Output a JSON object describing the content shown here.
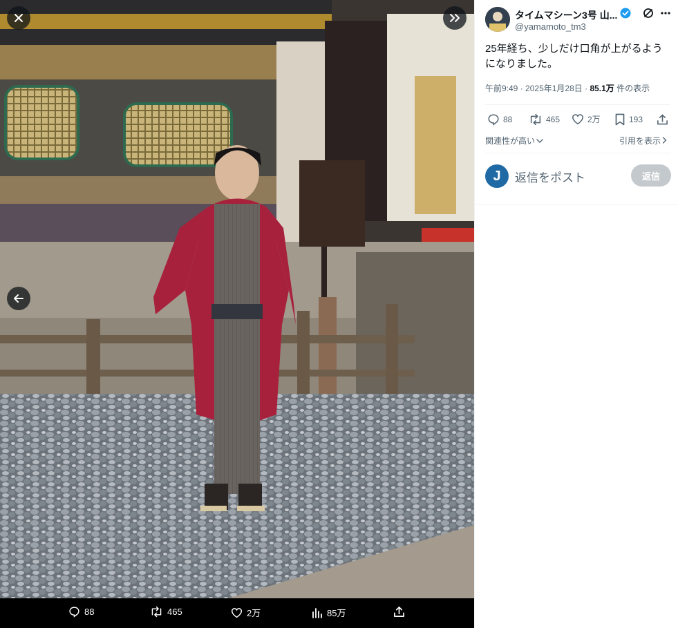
{
  "colors": {
    "accent": "#1d9bf0",
    "verified": "#1d9bf0",
    "text_primary": "#0f1419",
    "text_secondary": "#536471",
    "media_bg": "#000000",
    "reply_button_disabled": "#c4c9cd"
  },
  "viewer": {
    "icons": {
      "close": "close-icon",
      "expand": "chevrons-right-icon",
      "previous": "arrow-left-icon"
    },
    "photo_description_icon": "photo",
    "media_actions": {
      "replies": "88",
      "retweets": "465",
      "likes": "2万",
      "views": "85万"
    }
  },
  "tweet": {
    "author": {
      "display_name": "タイムマシーン3号 山...",
      "handle": "@yamamoto_tm3",
      "verified": true
    },
    "text": "25年経ち、少しだけ口角が上がるようになりました。",
    "meta": {
      "time": "午前9:49",
      "sep1": "·",
      "date": "2025年1月28日",
      "sep2": "·",
      "views": "85.1万",
      "views_suffix": "件の表示"
    },
    "stats": {
      "replies": "88",
      "retweets": "465",
      "likes": "2万",
      "bookmarks": "193"
    },
    "sort_label": "関連性が高い",
    "quote_label": "引用を表示"
  },
  "reply": {
    "avatar_letter": "J",
    "placeholder": "返信をポスト",
    "button_label": "返信"
  }
}
